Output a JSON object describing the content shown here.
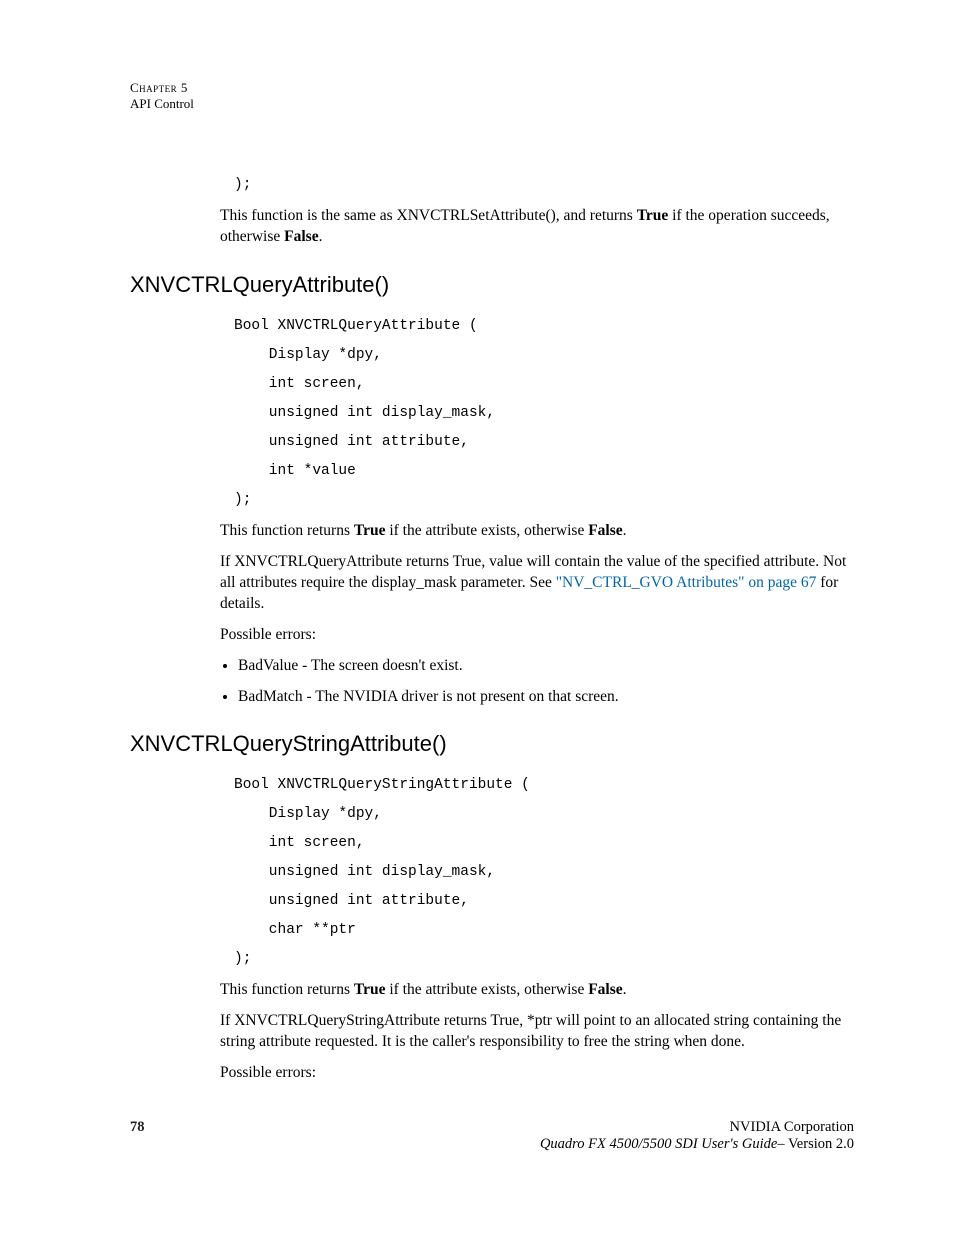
{
  "header": {
    "chapter_label": "Chapter 5",
    "section_label": "API Control"
  },
  "intro": {
    "code_tail": ");",
    "para_pre": "This function is the same as XNVCTRLSetAttribute(), and returns ",
    "true": "True",
    "para_mid": " if the operation succeeds, otherwise ",
    "false": "False",
    "para_post": "."
  },
  "section1": {
    "heading": "XNVCTRLQueryAttribute()",
    "code": "Bool XNVCTRLQueryAttribute (\n    Display *dpy,\n    int screen,\n    unsigned int display_mask,\n    unsigned int attribute,\n    int *value\n);",
    "p1_pre": "This function returns ",
    "p1_true": "True",
    "p1_mid": " if the attribute exists, otherwise ",
    "p1_false": "False",
    "p1_post": ".",
    "p2_pre": "If XNVCTRLQueryAttribute returns True, value will contain the value of the specified attribute. Not all attributes require the display_mask parameter. See ",
    "p2_link": "\"NV_CTRL_GVO Attributes\" on page 67",
    "p2_post": " for details.",
    "p3": " Possible errors:",
    "err1": "BadValue - The screen doesn't exist.",
    "err2": "BadMatch - The NVIDIA driver is not present on that screen."
  },
  "section2": {
    "heading": "XNVCTRLQueryStringAttribute()",
    "code": "Bool XNVCTRLQueryStringAttribute (\n    Display *dpy,\n    int screen,\n    unsigned int display_mask,\n    unsigned int attribute,\n    char **ptr\n);",
    "p1_pre": "This function returns ",
    "p1_true": "True",
    "p1_mid": " if the attribute exists, otherwise ",
    "p1_false": "False",
    "p1_post": ".",
    "p2": "If XNVCTRLQueryStringAttribute returns True, *ptr will point to an allocated string containing the string attribute requested.  It is  the caller's responsibility to free the string when done.",
    "p3": "Possible errors:"
  },
  "footer": {
    "page_number": "78",
    "company": "NVIDIA Corporation",
    "doc_title": "Quadro FX 4500/5500 SDI User's Guide",
    "version_sep": "– ",
    "version": "Version 2.0"
  }
}
